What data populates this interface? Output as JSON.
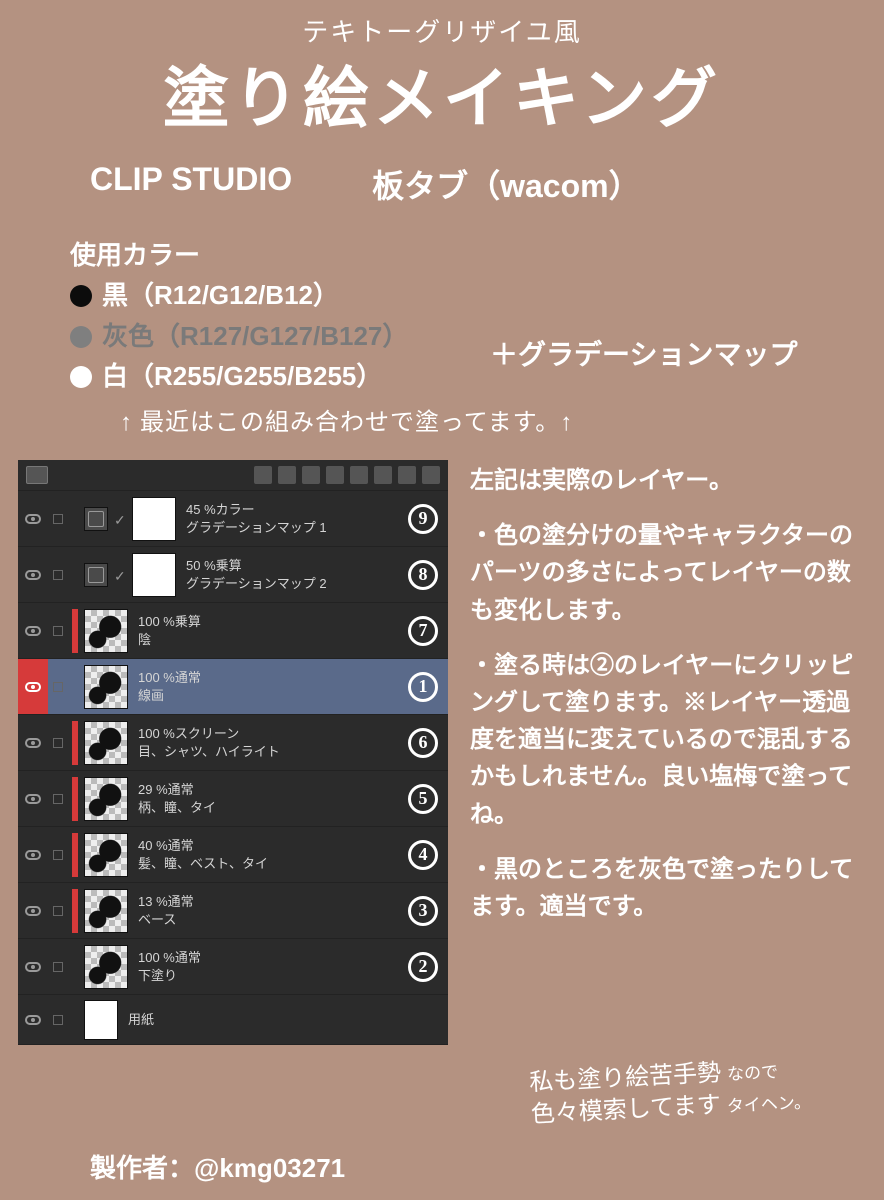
{
  "header": {
    "subtitle": "テキトーグリザイユ風",
    "title": "塗り絵メイキング",
    "tool1": "CLIP STUDIO",
    "tool2": "板タブ（wacom）"
  },
  "colors": {
    "heading": "使用カラー",
    "black": "黒（R12/G12/B12）",
    "grey": "灰色（R127/G127/B127）",
    "white": "白（R255/G255/B255）",
    "plus": "＋グラデーションマップ"
  },
  "handnote1": "↑ 最近はこの組み合わせで塗ってます。↑",
  "layers": [
    {
      "mode": "45 %カラー",
      "name": "グラデーションマップ 1",
      "ann": "9",
      "adj": true,
      "clip": false
    },
    {
      "mode": "50 %乗算",
      "name": "グラデーションマップ 2",
      "ann": "8",
      "adj": true,
      "clip": false
    },
    {
      "mode": "100 %乗算",
      "name": "陰",
      "ann": "7",
      "clip": true
    },
    {
      "mode": "100 %通常",
      "name": "線画",
      "ann": "1",
      "selected": true,
      "clip": false
    },
    {
      "mode": "100 %スクリーン",
      "name": "目、シャツ、ハイライト",
      "ann": "6",
      "clip": true
    },
    {
      "mode": "29 %通常",
      "name": "柄、瞳、タイ",
      "ann": "5",
      "clip": true
    },
    {
      "mode": "40 %通常",
      "name": "髪、瞳、ベスト、タイ",
      "ann": "4",
      "clip": true
    },
    {
      "mode": "13 %通常",
      "name": "ベース",
      "ann": "3",
      "clip": true
    },
    {
      "mode": "100 %通常",
      "name": "下塗り",
      "ann": "2",
      "clip": false
    },
    {
      "mode": "",
      "name": "用紙",
      "ann": "",
      "paper": true,
      "clip": false
    }
  ],
  "right": {
    "p1": "左記は実際のレイヤー。",
    "p2": "・色の塗分けの量やキャラクターのパーツの多さによってレイヤーの数も変化します。",
    "p3": "・塗る時は②のレイヤーにクリッピングして塗ります。※レイヤー透過度を適当に変えているので混乱するかもしれません。良い塩梅で塗ってね。",
    "p4": "・黒のところを灰色で塗ったりしてます。適当です。"
  },
  "handnote2_l1": "私も塗り絵苦手勢",
  "handnote2_l1b": "なので",
  "handnote2_l2": "色々模索してます",
  "handnote2_l2b": "タイヘン。",
  "credit": "製作者：@kmg03271"
}
